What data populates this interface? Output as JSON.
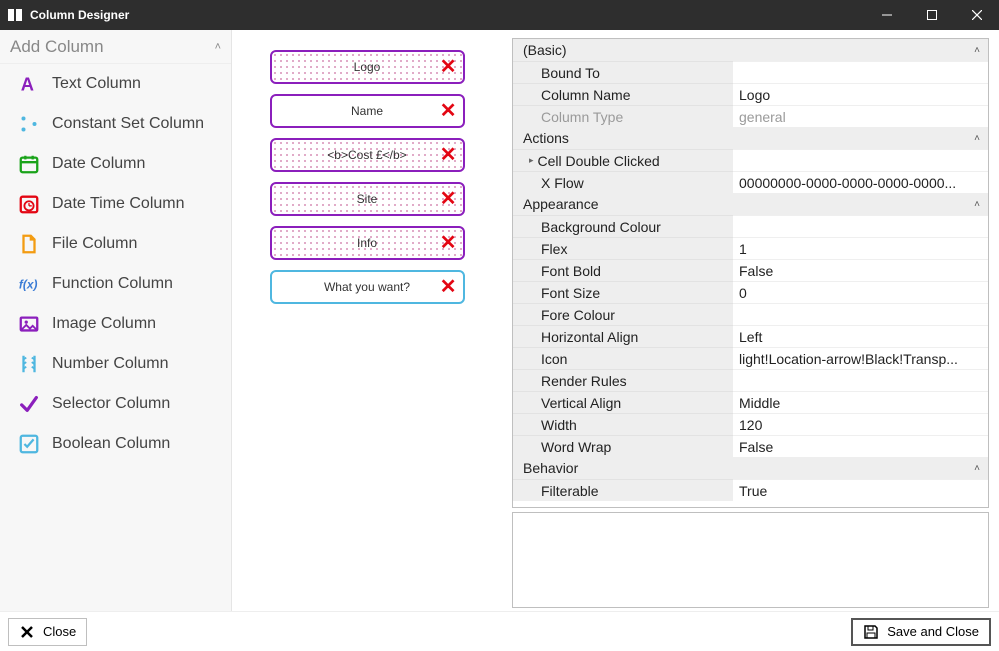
{
  "window": {
    "title": "Column Designer"
  },
  "sidebar": {
    "header": "Add Column",
    "items": [
      {
        "label": "Text Column",
        "icon": "text"
      },
      {
        "label": "Constant Set Column",
        "icon": "constant"
      },
      {
        "label": "Date Column",
        "icon": "date"
      },
      {
        "label": "Date Time Column",
        "icon": "datetime"
      },
      {
        "label": "File Column",
        "icon": "file"
      },
      {
        "label": "Function Column",
        "icon": "function"
      },
      {
        "label": "Image Column",
        "icon": "image"
      },
      {
        "label": "Number Column",
        "icon": "number"
      },
      {
        "label": "Selector Column",
        "icon": "selector"
      },
      {
        "label": "Boolean Column",
        "icon": "boolean"
      }
    ]
  },
  "columns": [
    {
      "label": "Logo",
      "dotted": true,
      "border": "purple"
    },
    {
      "label": "Name",
      "dotted": false,
      "border": "purple"
    },
    {
      "label": "<b>Cost £</b>",
      "dotted": true,
      "border": "purple"
    },
    {
      "label": "Site",
      "dotted": true,
      "border": "purple"
    },
    {
      "label": "Info",
      "dotted": true,
      "border": "purple"
    },
    {
      "label": "What you want?",
      "dotted": false,
      "border": "blue"
    }
  ],
  "props": {
    "categories": [
      {
        "name": "(Basic)",
        "rows": [
          {
            "k": "Bound To",
            "v": ""
          },
          {
            "k": "Column Name",
            "v": "Logo"
          },
          {
            "k": "Column Type",
            "v": "general",
            "readonly": true
          }
        ]
      },
      {
        "name": "Actions",
        "rows": [
          {
            "k": "Cell Double Clicked",
            "v": "",
            "expand": true
          },
          {
            "k": "X Flow",
            "v": "00000000-0000-0000-0000-0000..."
          }
        ]
      },
      {
        "name": "Appearance",
        "rows": [
          {
            "k": "Background Colour",
            "v": ""
          },
          {
            "k": "Flex",
            "v": "1"
          },
          {
            "k": "Font Bold",
            "v": "False"
          },
          {
            "k": "Font Size",
            "v": "0"
          },
          {
            "k": "Fore Colour",
            "v": ""
          },
          {
            "k": "Horizontal Align",
            "v": "Left"
          },
          {
            "k": "Icon",
            "v": "light!Location-arrow!Black!Transp..."
          },
          {
            "k": "Render Rules",
            "v": ""
          },
          {
            "k": "Vertical Align",
            "v": "Middle"
          },
          {
            "k": "Width",
            "v": "120"
          },
          {
            "k": "Word Wrap",
            "v": "False"
          }
        ]
      },
      {
        "name": "Behavior",
        "rows": [
          {
            "k": "Filterable",
            "v": "True"
          }
        ]
      }
    ]
  },
  "footer": {
    "close": "Close",
    "save": "Save and Close"
  }
}
